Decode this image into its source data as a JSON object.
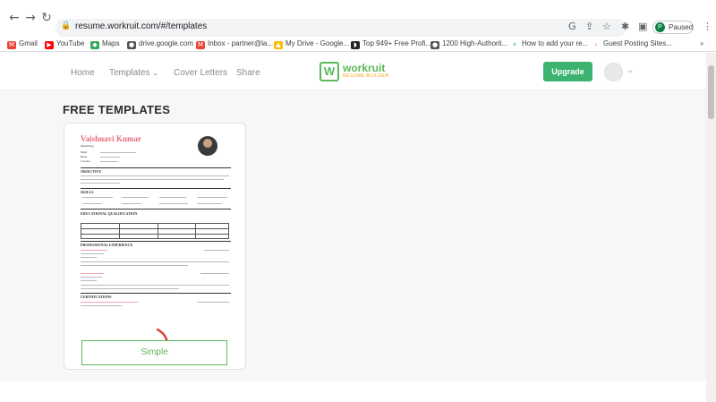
{
  "browser": {
    "url": "resume.workruit.com/#/templates",
    "status": "Paused",
    "profile_initial": "P",
    "bookmarks": [
      {
        "label": "Gmail",
        "icon": "gmail-icon"
      },
      {
        "label": "YouTube",
        "icon": "youtube-icon"
      },
      {
        "label": "Maps",
        "icon": "maps-icon"
      },
      {
        "label": "drive.google.com",
        "icon": "globe-icon"
      },
      {
        "label": "Inbox - partner@la...",
        "icon": "gmail-icon"
      },
      {
        "label": "My Drive - Google...",
        "icon": "drive-icon"
      },
      {
        "label": "Top 949+ Free Profi...",
        "icon": "site-icon"
      },
      {
        "label": "1200 High-Authorit...",
        "icon": "globe-icon"
      },
      {
        "label": "How to add your re...",
        "icon": "bolt-icon"
      },
      {
        "label": "Guest Posting Sites...",
        "icon": "chevron-icon"
      }
    ]
  },
  "header": {
    "nav": [
      "Home",
      "Templates",
      "Cover Letters",
      "Share"
    ],
    "logo_word": "workruit",
    "logo_tag": "RESUME BUILDER",
    "upgrade_label": "Upgrade"
  },
  "main": {
    "section_title": "FREE TEMPLATES",
    "template": {
      "name": "Vaishnavi Kumar",
      "role": "Marketing",
      "info": [
        "Email",
        "Phone",
        "Location"
      ],
      "sections": [
        "OBJECTIVE",
        "SKILLS",
        "EDUCATIONAL QUALIFICATION",
        "PROFESSIONAL EXPERIENCE",
        "CERTIFICATIONS"
      ],
      "button_label": "Simple"
    }
  },
  "colors": {
    "accent_green": "#5cb85c",
    "upgrade_green": "#3cb371",
    "name_pink": "#e56a7a",
    "arrow_red": "#d9453d"
  }
}
